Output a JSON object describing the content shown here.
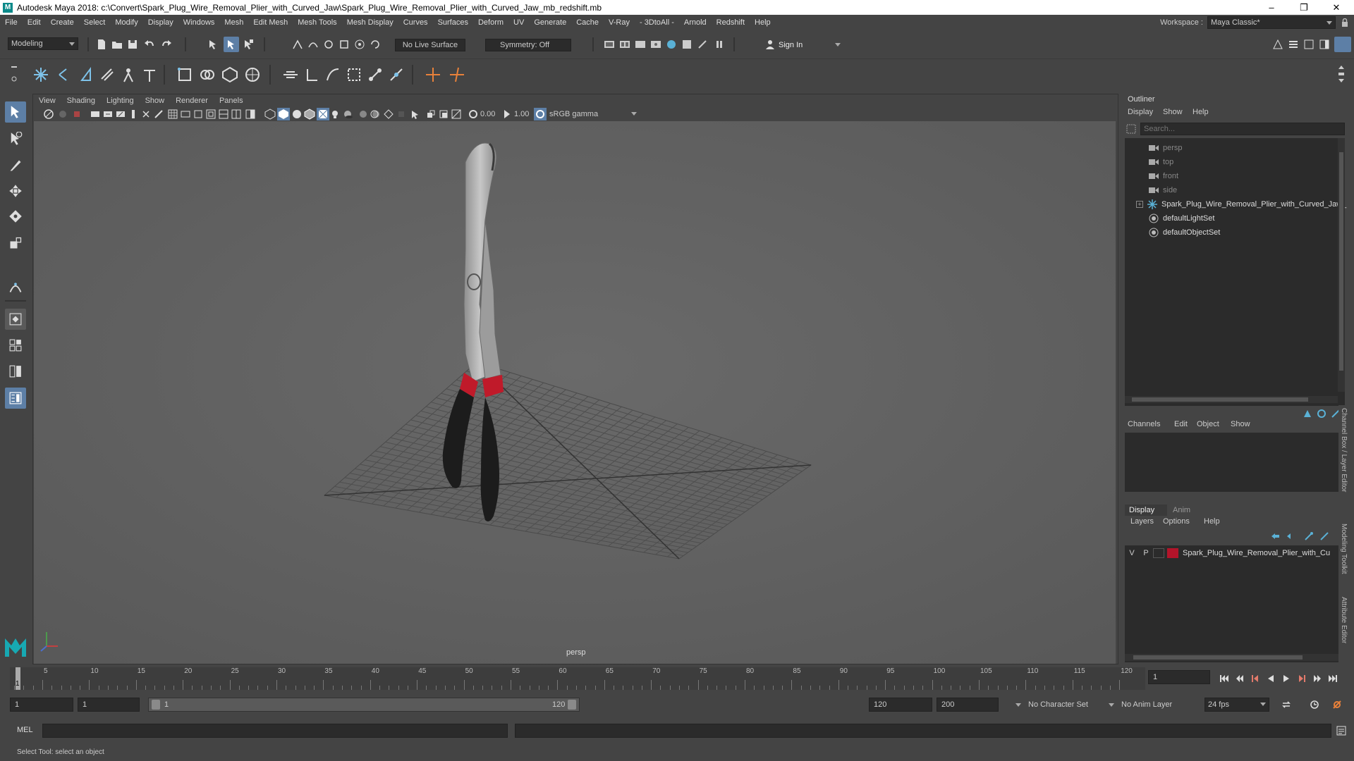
{
  "title": "Autodesk Maya 2018: c:\\Convert\\Spark_Plug_Wire_Removal_Plier_with_Curved_Jaw\\Spark_Plug_Wire_Removal_Plier_with_Curved_Jaw_mb_redshift.mb",
  "menus": [
    "File",
    "Edit",
    "Create",
    "Select",
    "Modify",
    "Display",
    "Windows",
    "Mesh",
    "Edit Mesh",
    "Mesh Tools",
    "Mesh Display",
    "Curves",
    "Surfaces",
    "Deform",
    "UV",
    "Generate",
    "Cache",
    "V-Ray",
    "- 3DtoAll -",
    "Arnold",
    "Redshift",
    "Help"
  ],
  "workspace": {
    "label": "Workspace :",
    "value": "Maya Classic*"
  },
  "status": {
    "mode": "Modeling",
    "live_surface": "No Live Surface",
    "symmetry": "Symmetry: Off",
    "sign_in": "Sign In"
  },
  "viewport": {
    "menus": [
      "View",
      "Shading",
      "Lighting",
      "Show",
      "Renderer",
      "Panels"
    ],
    "near": "0.00",
    "far": "1.00",
    "colorspace": "sRGB gamma",
    "camera": "persp"
  },
  "outliner": {
    "title": "Outliner",
    "menus": [
      "Display",
      "Show",
      "Help"
    ],
    "search_placeholder": "Search...",
    "items": [
      "persp",
      "top",
      "front",
      "side",
      "Spark_Plug_Wire_Removal_Plier_with_Curved_Jaw_",
      "defaultLightSet",
      "defaultObjectSet"
    ]
  },
  "channelbox": {
    "menus": [
      "Channels",
      "Edit",
      "Object",
      "Show"
    ]
  },
  "layers": {
    "tabs": [
      "Display",
      "Anim"
    ],
    "menus": [
      "Layers",
      "Options",
      "Help"
    ],
    "layer": {
      "v": "V",
      "p": "P",
      "name": "Spark_Plug_Wire_Removal_Plier_with_Cu",
      "color": "#b3142a"
    }
  },
  "sidetabs": [
    "Channel Box / Layer Editor",
    "Modeling Toolkit",
    "Attribute Editor"
  ],
  "timeline": {
    "ticks": [
      "5",
      "10",
      "15",
      "20",
      "25",
      "30",
      "35",
      "40",
      "45",
      "50",
      "55",
      "60",
      "65",
      "70",
      "75",
      "80",
      "85",
      "90",
      "95",
      "100",
      "105",
      "110",
      "115",
      "120"
    ],
    "start_label": "1",
    "current_frame": "1"
  },
  "range": {
    "start": "1",
    "inner_start": "1",
    "slider_start": "1",
    "slider_end": "120",
    "end": "120",
    "max": "200",
    "char_set": "No Character Set",
    "anim_layer": "No Anim Layer",
    "fps": "24 fps"
  },
  "cmd": {
    "label": "MEL"
  },
  "help": {
    "text": "Select Tool: select an object"
  }
}
